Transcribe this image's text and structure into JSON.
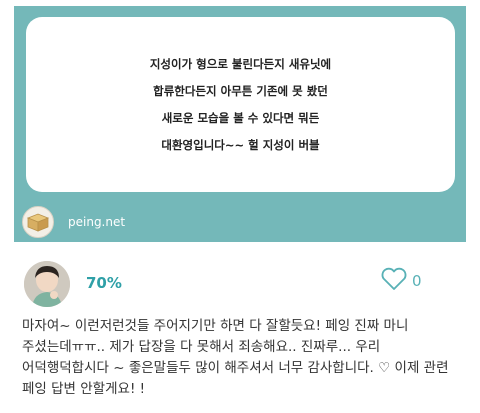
{
  "question": {
    "lines": [
      "지성이가 형으로 불린다든지 새유닛에",
      "합류한다든지 아무튼 기존에 못 봤던",
      "새로운 모습을 볼 수 있다면 뭐든",
      "대환영입니다~~ 헐 지성이 버블"
    ]
  },
  "brand": {
    "name": "peing.net",
    "logo_icon": "peing-box-icon"
  },
  "answer": {
    "percent_label": "70%",
    "like_count": "0",
    "like_icon": "heart-outline-icon",
    "text": "마자여~ 이런저런것들 주어지기만 하면 다 잘할듯요! 페잉 진짜 마니 주셨는데ㅠㅠ.. 제가 답장을 다 못해서 죄송해요.. 진짜루... 우리 어덕행덕합시다 ~ 좋은말들두 많이 해주셔서 너무 감사합니다. ♡ 이제 관련 페잉 답변 안할게요! !"
  },
  "colors": {
    "card_bg": "#74b8b9",
    "accent": "#2fa0a7",
    "heart": "#58b1b6"
  }
}
